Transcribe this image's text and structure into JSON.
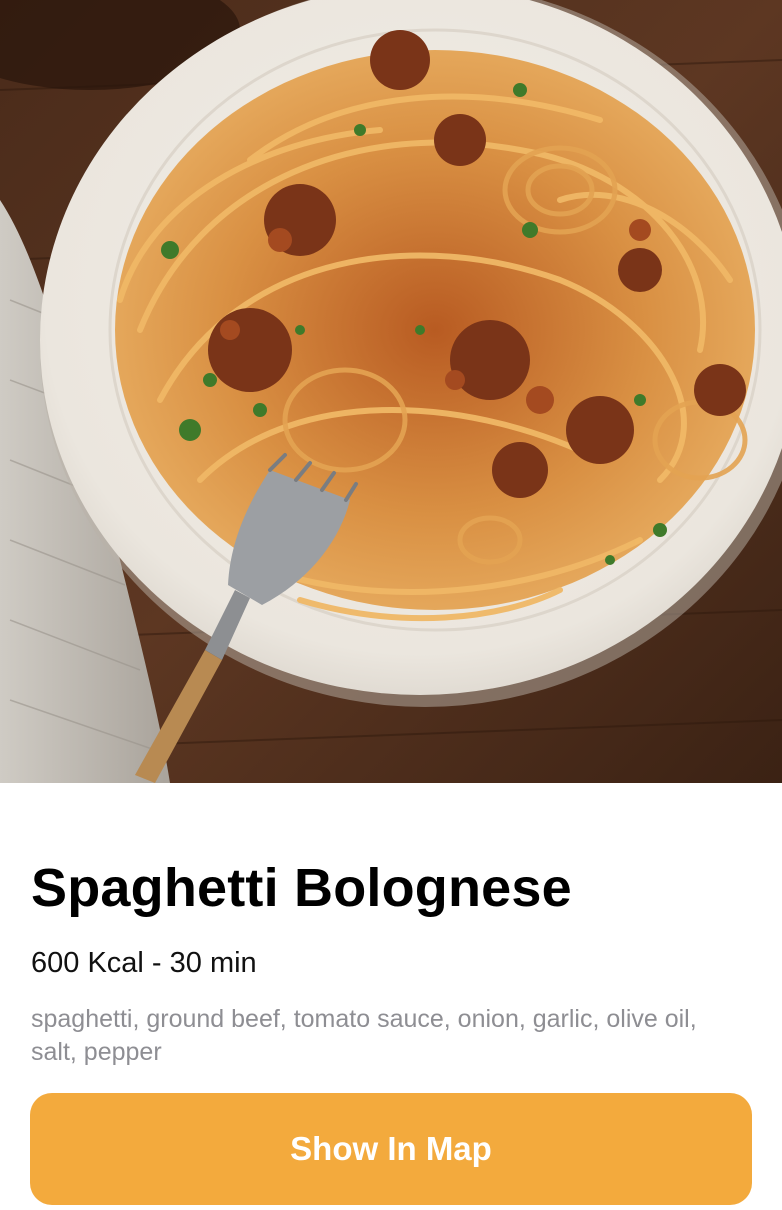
{
  "recipe": {
    "image_alt": "plate-of-spaghetti-bolognese-photo",
    "title": "Spaghetti Bolognese",
    "meta": "600 Kcal - 30 min",
    "ingredients": "spaghetti, ground beef, tomato sauce, onion, garlic, olive oil, salt, pepper"
  },
  "actions": {
    "show_in_map_label": "Show In Map"
  },
  "colors": {
    "accent": "#f3aa3d",
    "title": "#000000",
    "meta": "#111111",
    "secondary_text": "#8e8e93",
    "background": "#ffffff"
  }
}
